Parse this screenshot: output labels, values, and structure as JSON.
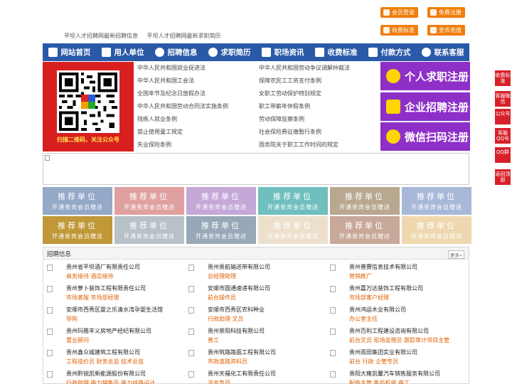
{
  "top_links": [
    "平坝人才招聘网最新招聘信息",
    "平坝人才招聘网最新求职简历"
  ],
  "top_buttons": {
    "member_login": "会员登录",
    "free_register": "免费注册",
    "fee_standard": "收费标准",
    "coin_recharge": "金币充值"
  },
  "nav": [
    {
      "label": "网站首页",
      "icon": "home-icon"
    },
    {
      "label": "用人单位",
      "icon": "building-icon"
    },
    {
      "label": "招聘信息",
      "icon": "person-icon"
    },
    {
      "label": "求职简历",
      "icon": "search-icon"
    },
    {
      "label": "职场资讯",
      "icon": "document-icon"
    },
    {
      "label": "收费标准",
      "icon": "bag-icon"
    },
    {
      "label": "付款方式",
      "icon": "card-icon"
    },
    {
      "label": "联系客服",
      "icon": "phone-icon"
    }
  ],
  "qr_caption": "扫描二维码，关注公众号",
  "laws_left": [
    "中华人民共和国就业促进法",
    "中华人民共和国工会法",
    "全国年节及纪念日放假办法",
    "中华人民共和国劳动合同法实施条例",
    "残疾人就业条例",
    "禁止使用童工规定",
    "失业保险条例"
  ],
  "laws_right": [
    "中华人民共和国劳动争议调解仲裁法",
    "保障农民工工资支付条例",
    "女职工劳动保护特别规定",
    "职工带薪年休假条例",
    "劳动保障监察条例",
    "社会保险费征缴暂行条例",
    "国务院关于职工工作时间的规定"
  ],
  "big_buttons": [
    "个人求职注册",
    "企业招聘注册",
    "微信扫码注册"
  ],
  "side_buttons": [
    "收费标准",
    "客服微信",
    "公众号",
    "客服QQ号",
    "QQ群",
    "返回顶部"
  ],
  "tile": {
    "title": "推荐单位",
    "subtitle": "开通贵宾会员赠送"
  },
  "tile_colors": [
    "#94a8c8",
    "#e0a0a0",
    "#c4a8d8",
    "#6fbfbf",
    "#b8a890",
    "#a8b8d8",
    "#c09838",
    "#b8c0c8",
    "#98a8b8",
    "#ece0cc",
    "#c8a898",
    "#efd8b0"
  ],
  "jobs_title": "招聘信息",
  "more_label": "更多»",
  "jobs": [
    {
      "company": "贵州省平坝酒厂有限责任公司",
      "positions": "商务接待  酒店接待"
    },
    {
      "company": "贵州贵航输送带有限公司",
      "positions": "总经理助理"
    },
    {
      "company": "贵州普赛信息技术有限公司",
      "positions": "营销推广"
    },
    {
      "company": "贵州萝卜装饰工程有限责任公司",
      "positions": "市场客服  市场部经理"
    },
    {
      "company": "安顺市圆通速递有限公司",
      "positions": "前台操作员"
    },
    {
      "company": "贵州嘉万达装饰工程有限公司",
      "positions": "市场部客户经理"
    },
    {
      "company": "安顺市西秀区婴之乐清水湾孕婴生活馆",
      "positions": "导购"
    },
    {
      "company": "安顺市西秀区农科种业",
      "positions": "行政助理  文员"
    },
    {
      "company": "贵州鸿运木业有限公司",
      "positions": "办公室主任"
    },
    {
      "company": "贵州玛雅丰义房地产经纪有限公司",
      "positions": "置业顾问"
    },
    {
      "company": "贵州景阳科技有限公司",
      "positions": "普工"
    },
    {
      "company": "贵州百利工程建设咨询有限公司",
      "positions": "前台文员  现场监理员  跟踪审计项目主管"
    },
    {
      "company": "贵州鑫众城建筑工程有限公司",
      "positions": "工程造价员  财务总监  技术总监"
    },
    {
      "company": "贵州筑路路面工程有限公司",
      "positions": "市政道路资料员"
    },
    {
      "company": "贵州雨田集团实业有限公司",
      "positions": "前台  行政  企管专员"
    },
    {
      "company": "贵州黔锐凯新能源股份有限公司",
      "positions": "行政助理  电力销售员  电力线路设计"
    },
    {
      "company": "贵州天福化工有限责任公司",
      "positions": "法务专员"
    },
    {
      "company": "贵阳大雍凯馨汽车销售服务有限公司",
      "positions": "配件主管  售后机修  电工"
    }
  ],
  "colors": {
    "nav": "#2a59a8",
    "orange": "#f07e0c",
    "purple": "#8e2fc8",
    "red": "#d81e1e",
    "side_red": "#d8202a"
  }
}
